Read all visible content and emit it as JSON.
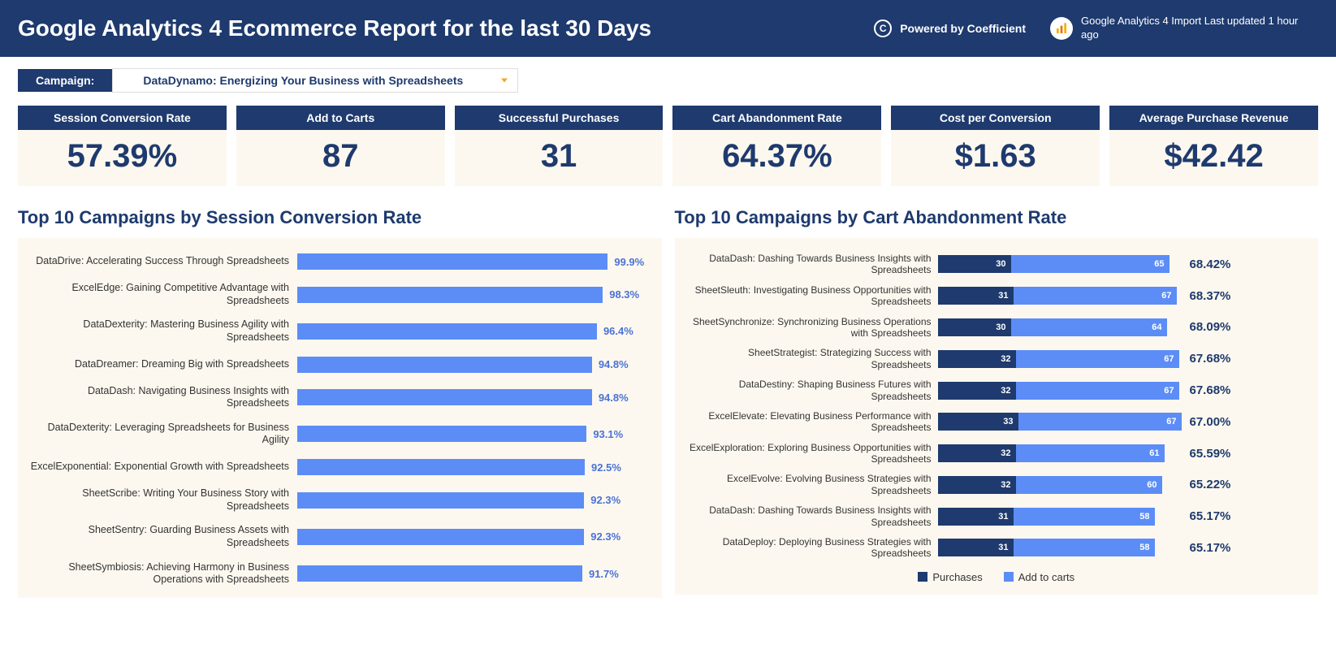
{
  "header": {
    "title": "Google Analytics 4 Ecommerce Report for the last 30 Days",
    "powered_label": "Powered by Coefficient",
    "import_status": "Google Analytics 4 Import Last updated 1 hour ago"
  },
  "filter": {
    "label": "Campaign:",
    "value": "DataDynamo: Energizing Your Business with Spreadsheets"
  },
  "kpis": [
    {
      "label": "Session Conversion Rate",
      "value": "57.39%"
    },
    {
      "label": "Add to Carts",
      "value": "87"
    },
    {
      "label": "Successful Purchases",
      "value": "31"
    },
    {
      "label": "Cart Abandonment Rate",
      "value": "64.37%"
    },
    {
      "label": "Cost per Conversion",
      "value": "$1.63"
    },
    {
      "label": "Average Purchase Revenue",
      "value": "$42.42"
    }
  ],
  "chart_left_title": "Top 10 Campaigns by Session Conversion Rate",
  "chart_right_title": "Top 10 Campaigns by Cart Abandonment Rate",
  "legend": {
    "s1": "Purchases",
    "s2": "Add to carts"
  },
  "chart_data": [
    {
      "type": "bar",
      "title": "Top 10 Campaigns by Session Conversion Rate",
      "orientation": "horizontal",
      "xlabel": "",
      "ylabel": "",
      "xlim": [
        0,
        100
      ],
      "categories": [
        "DataDrive: Accelerating Success Through Spreadsheets",
        "ExcelEdge: Gaining Competitive Advantage with Spreadsheets",
        "DataDexterity: Mastering Business Agility with Spreadsheets",
        "DataDreamer: Dreaming Big with Spreadsheets",
        "DataDash: Navigating Business Insights with Spreadsheets",
        "DataDexterity: Leveraging Spreadsheets for Business Agility",
        "ExcelExponential: Exponential Growth with Spreadsheets",
        "SheetScribe: Writing Your Business Story with Spreadsheets",
        "SheetSentry: Guarding Business Assets with Spreadsheets",
        "SheetSymbiosis: Achieving Harmony in Business Operations with Spreadsheets"
      ],
      "values": [
        99.9,
        98.3,
        96.4,
        94.8,
        94.8,
        93.1,
        92.5,
        92.3,
        92.3,
        91.7
      ],
      "value_labels": [
        "99.9%",
        "98.3%",
        "96.4%",
        "94.8%",
        "94.8%",
        "93.1%",
        "92.5%",
        "92.3%",
        "92.3%",
        "91.7%"
      ]
    },
    {
      "type": "bar",
      "stacked": true,
      "title": "Top 10 Campaigns by Cart Abandonment Rate",
      "orientation": "horizontal",
      "xlabel": "",
      "ylabel": "",
      "xlim": [
        0,
        100
      ],
      "categories": [
        "DataDash: Dashing Towards Business Insights with Spreadsheets",
        "SheetSleuth: Investigating Business Opportunities with Spreadsheets",
        "SheetSynchronize: Synchronizing Business Operations with Spreadsheets",
        "SheetStrategist: Strategizing Success with Spreadsheets",
        "DataDestiny: Shaping Business Futures with Spreadsheets",
        "ExcelElevate: Elevating Business Performance with Spreadsheets",
        "ExcelExploration: Exploring Business Opportunities with Spreadsheets",
        "ExcelEvolve: Evolving Business Strategies with Spreadsheets",
        "DataDash: Dashing Towards Business Insights with Spreadsheets",
        "DataDeploy: Deploying Business Strategies with Spreadsheets"
      ],
      "series": [
        {
          "name": "Purchases",
          "values": [
            30,
            31,
            30,
            32,
            32,
            33,
            32,
            32,
            31,
            31
          ]
        },
        {
          "name": "Add to carts",
          "values": [
            65,
            67,
            64,
            67,
            67,
            67,
            61,
            60,
            58,
            58
          ]
        }
      ],
      "row_labels": [
        "68.42%",
        "68.37%",
        "68.09%",
        "67.68%",
        "67.68%",
        "67.00%",
        "65.59%",
        "65.22%",
        "65.17%",
        "65.17%"
      ]
    }
  ]
}
